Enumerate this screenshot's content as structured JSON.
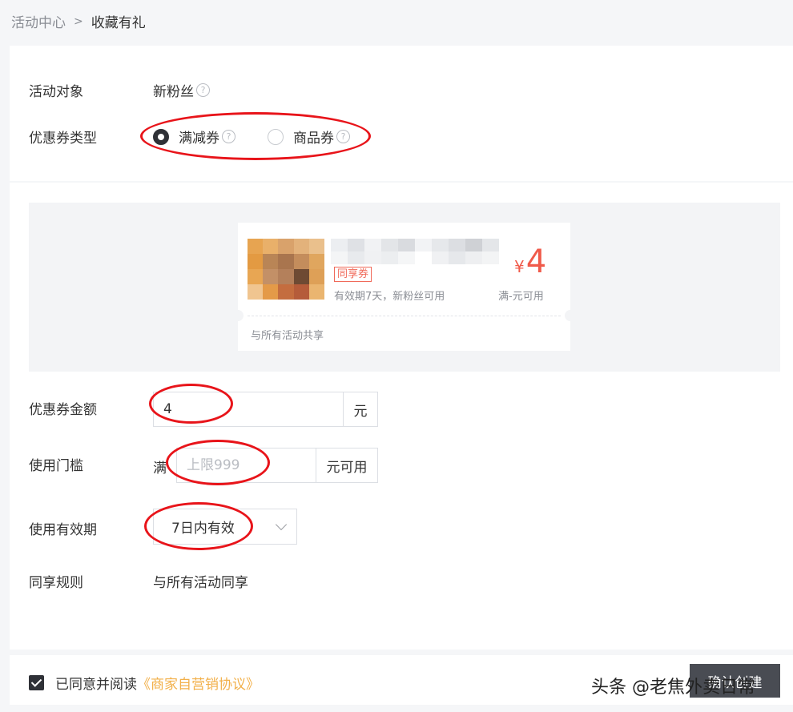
{
  "breadcrumb": {
    "parent": "活动中心",
    "separator": ">",
    "current": "收藏有礼"
  },
  "form": {
    "target": {
      "label": "活动对象",
      "value": "新粉丝"
    },
    "coupon_type": {
      "label": "优惠券类型",
      "options": [
        "满减券",
        "商品券"
      ],
      "selected": "满减券"
    },
    "amount": {
      "label": "优惠券金额",
      "value": "4",
      "unit": "元"
    },
    "threshold": {
      "label": "使用门槛",
      "prefix": "满",
      "placeholder": "上限999",
      "unit": "元可用"
    },
    "validity": {
      "label": "使用有效期",
      "value": "7日内有效"
    },
    "share_rule": {
      "label": "同享规则",
      "value": "与所有活动同享"
    }
  },
  "coupon_preview": {
    "tag": "同享券",
    "validity": "有效期7天，新粉丝可用",
    "currency": "¥",
    "price": "4",
    "condition": "满-元可用",
    "share_note": "与所有活动共享"
  },
  "agreement": {
    "text": "已同意并阅读",
    "link": "《商家自营销协议》",
    "checked": true
  },
  "submit": {
    "label": "确认创建"
  },
  "watermark": {
    "text": "头条 @老焦外卖日常"
  },
  "colors": {
    "price": "#f05a4a",
    "link": "#f2b04a",
    "annotation": "#e8141a",
    "dark": "#2f3137"
  }
}
